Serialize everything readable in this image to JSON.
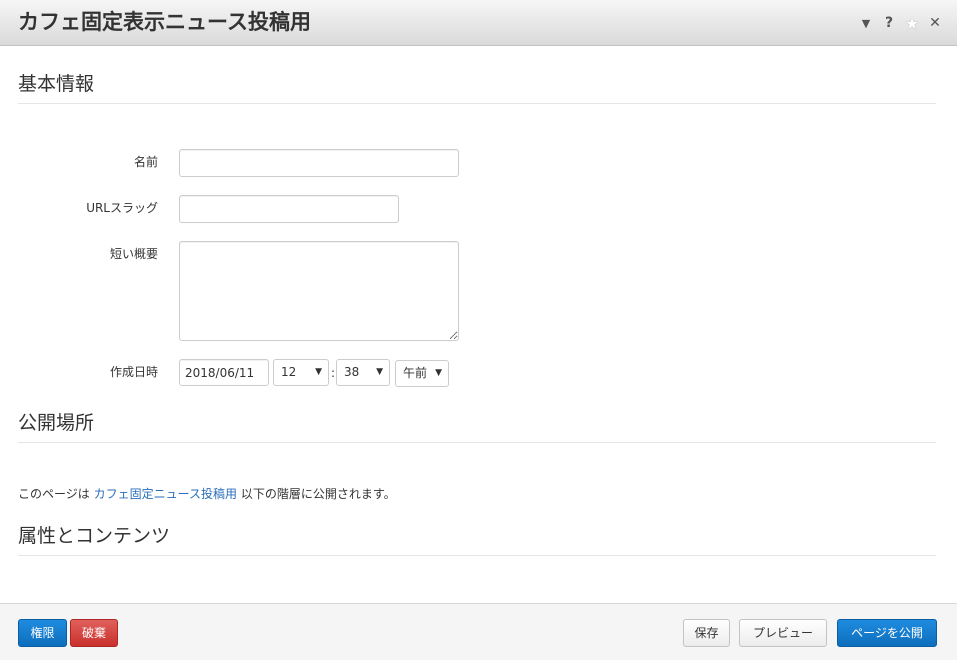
{
  "dialog": {
    "title": "カフェ固定表示ニュース投稿用",
    "tools": {
      "collapse": "▼",
      "help": "?",
      "favorite": "★",
      "close": "✕"
    }
  },
  "basic_info": {
    "heading": "基本情報",
    "name_label": "名前",
    "name_value": "",
    "slug_label": "URLスラッグ",
    "slug_value": "",
    "summary_label": "短い概要",
    "summary_value": "",
    "created_label": "作成日時",
    "date_value": "2018/06/11",
    "hour_value": "12",
    "time_separator": ":",
    "minute_value": "38",
    "ampm_value": "午前"
  },
  "publish_location": {
    "heading": "公開場所",
    "text_prefix": "このページは",
    "link_text": "カフェ固定ニュース投稿用",
    "text_suffix": "以下の階層に公開されます。"
  },
  "attributes": {
    "heading": "属性とコンテンツ"
  },
  "footer": {
    "permissions_label": "権限",
    "discard_label": "破棄",
    "save_label": "保存",
    "preview_label": "プレビュー",
    "publish_label": "ページを公開"
  }
}
